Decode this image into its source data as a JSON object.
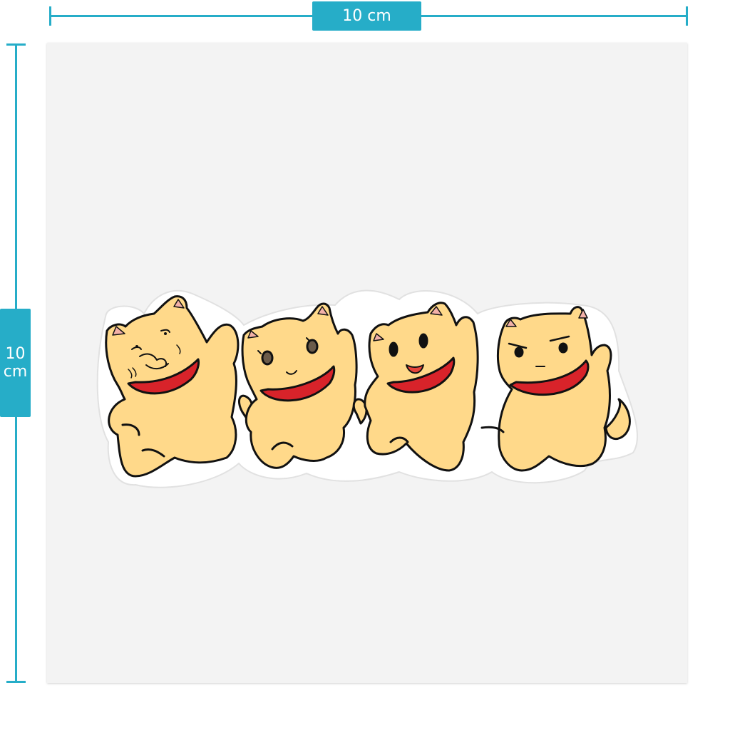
{
  "dimensions": {
    "width_label": "10 cm",
    "height_value": "10",
    "height_unit": "cm"
  },
  "product": {
    "sticker_subject": "four-yellow-cats-with-red-collars"
  },
  "colors": {
    "accent": "#26adc8",
    "board": "#f3f3f3",
    "cat_fill": "#ffd98a",
    "collar": "#d8232a",
    "ear_inner": "#f3b1a8",
    "outline": "#111111"
  }
}
